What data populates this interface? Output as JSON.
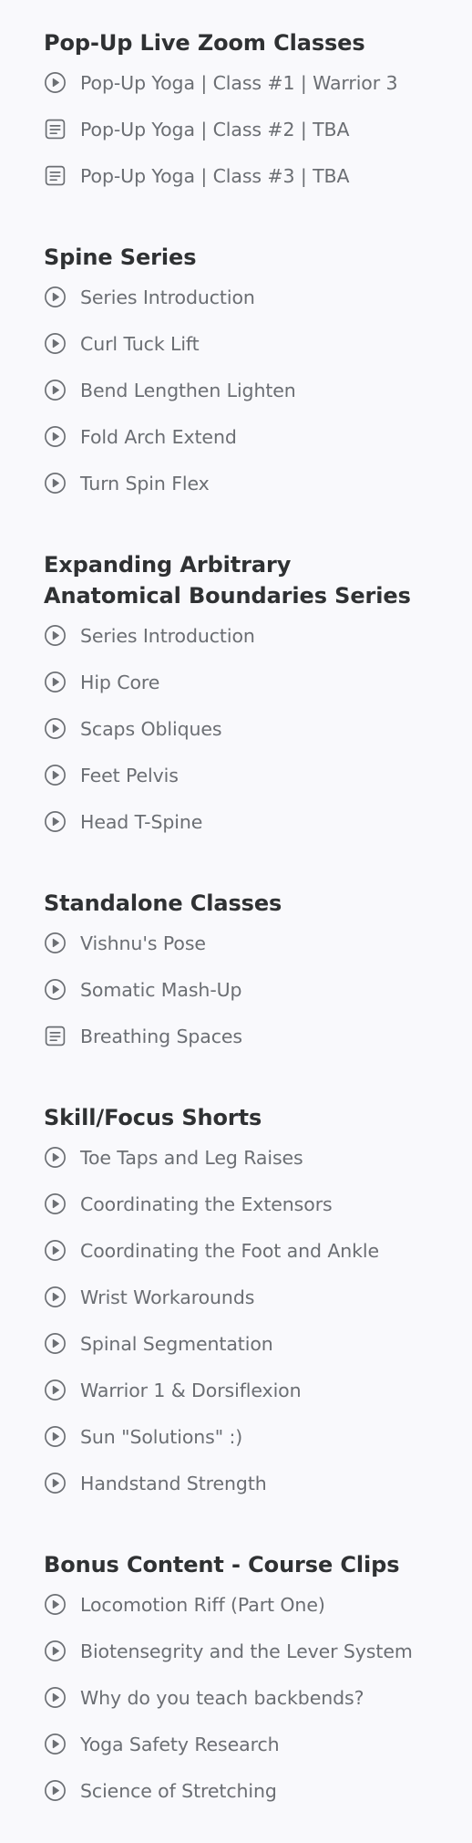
{
  "sections": [
    {
      "title": "Pop-Up Live Zoom Classes",
      "items": [
        {
          "label": "Pop-Up Yoga | Class #1 | Warrior 3",
          "icon": "play-circle-icon"
        },
        {
          "label": "Pop-Up Yoga | Class #2 | TBA",
          "icon": "document-icon"
        },
        {
          "label": "Pop-Up Yoga | Class #3 | TBA",
          "icon": "document-icon"
        }
      ]
    },
    {
      "title": "Spine Series",
      "items": [
        {
          "label": "Series Introduction",
          "icon": "play-circle-icon"
        },
        {
          "label": "Curl Tuck Lift",
          "icon": "play-circle-icon"
        },
        {
          "label": "Bend Lengthen Lighten",
          "icon": "play-circle-icon"
        },
        {
          "label": "Fold Arch Extend",
          "icon": "play-circle-icon"
        },
        {
          "label": "Turn Spin Flex",
          "icon": "play-circle-icon"
        }
      ]
    },
    {
      "title": "Expanding Arbitrary Anatomical Boundaries Series",
      "items": [
        {
          "label": "Series Introduction",
          "icon": "play-circle-icon"
        },
        {
          "label": "Hip Core",
          "icon": "play-circle-icon"
        },
        {
          "label": "Scaps Obliques",
          "icon": "play-circle-icon"
        },
        {
          "label": "Feet Pelvis",
          "icon": "play-circle-icon"
        },
        {
          "label": "Head T-Spine",
          "icon": "play-circle-icon"
        }
      ]
    },
    {
      "title": "Standalone Classes",
      "items": [
        {
          "label": "Vishnu's Pose",
          "icon": "play-circle-icon"
        },
        {
          "label": "Somatic Mash-Up",
          "icon": "play-circle-icon"
        },
        {
          "label": "Breathing Spaces",
          "icon": "document-icon"
        }
      ]
    },
    {
      "title": "Skill/Focus Shorts",
      "items": [
        {
          "label": "Toe Taps and Leg Raises",
          "icon": "play-circle-icon"
        },
        {
          "label": "Coordinating the Extensors",
          "icon": "play-circle-icon"
        },
        {
          "label": "Coordinating the Foot and Ankle",
          "icon": "play-circle-icon"
        },
        {
          "label": "Wrist Workarounds",
          "icon": "play-circle-icon"
        },
        {
          "label": "Spinal Segmentation",
          "icon": "play-circle-icon"
        },
        {
          "label": "Warrior 1 & Dorsiflexion",
          "icon": "play-circle-icon"
        },
        {
          "label": "Sun \"Solutions\" :)",
          "icon": "play-circle-icon"
        },
        {
          "label": "Handstand Strength",
          "icon": "play-circle-icon"
        }
      ]
    },
    {
      "title": "Bonus Content - Course Clips",
      "items": [
        {
          "label": "Locomotion Riff (Part One)",
          "icon": "play-circle-icon"
        },
        {
          "label": "Biotensegrity and the Lever System",
          "icon": "play-circle-icon"
        },
        {
          "label": "Why do you teach backbends?",
          "icon": "play-circle-icon"
        },
        {
          "label": "Yoga Safety Research",
          "icon": "play-circle-icon"
        },
        {
          "label": "Science of Stretching",
          "icon": "play-circle-icon"
        }
      ]
    }
  ],
  "colors": {
    "background": "#f9f9fc",
    "heading": "#2f3133",
    "item_text": "#6b6e73",
    "icon": "#6b6e73"
  }
}
